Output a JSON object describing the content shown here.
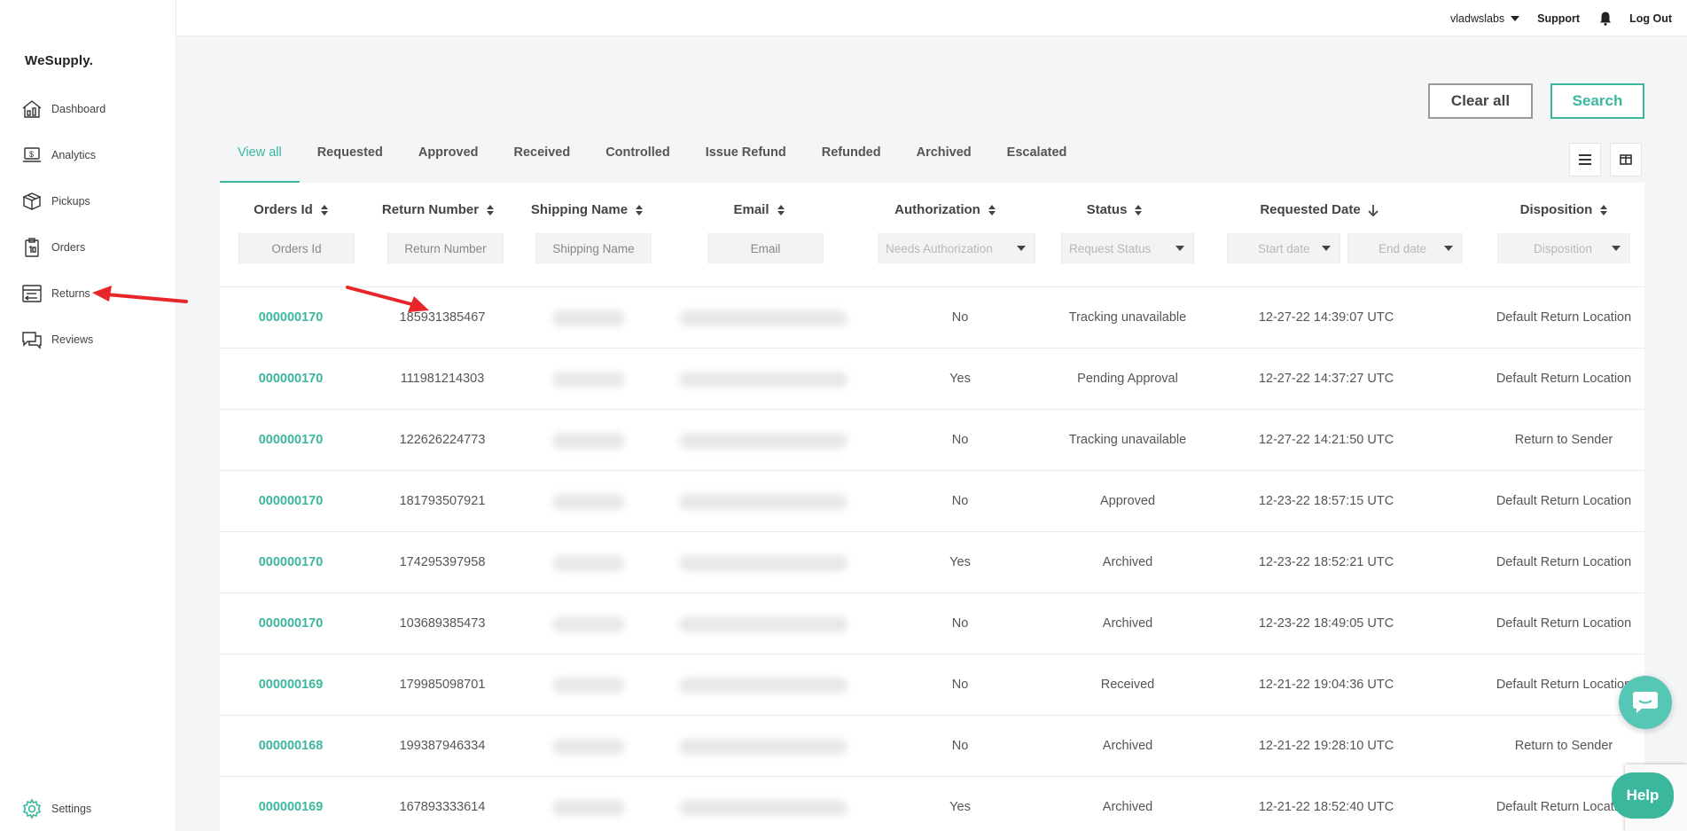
{
  "app": {
    "logo": "WeSupply."
  },
  "sidebar": {
    "items": [
      {
        "label": "Dashboard",
        "icon": "dashboard-icon"
      },
      {
        "label": "Analytics",
        "icon": "analytics-icon"
      },
      {
        "label": "Pickups",
        "icon": "box-icon"
      },
      {
        "label": "Orders",
        "icon": "clipboard-icon"
      },
      {
        "label": "Returns",
        "icon": "returns-icon"
      },
      {
        "label": "Reviews",
        "icon": "chat-icon"
      }
    ],
    "settings": {
      "label": "Settings",
      "icon": "gear-icon"
    }
  },
  "topbar": {
    "user": "vladwslabs",
    "support": "Support",
    "logout": "Log Out",
    "bell_icon": "bell-icon"
  },
  "actions": {
    "clear_label": "Clear all",
    "search_label": "Search"
  },
  "tabs": [
    "View all",
    "Requested",
    "Approved",
    "Received",
    "Controlled",
    "Issue Refund",
    "Refunded",
    "Archived",
    "Escalated"
  ],
  "view_toggles": {
    "list_icon": "list-view-icon",
    "grid_icon": "column-view-icon"
  },
  "table": {
    "columns": [
      {
        "label": "Orders Id",
        "filter": "Orders Id"
      },
      {
        "label": "Return Number",
        "filter": "Return Number"
      },
      {
        "label": "Shipping Name",
        "filter": "Shipping Name"
      },
      {
        "label": "Email",
        "filter": "Email"
      },
      {
        "label": "Authorization",
        "filter": "Needs Authorization"
      },
      {
        "label": "Status",
        "filter": "Request Status"
      },
      {
        "label": "Requested Date",
        "filter_start": "Start date",
        "filter_end": "End date"
      },
      {
        "label": "Disposition",
        "filter": "Disposition"
      }
    ],
    "rows": [
      {
        "order": "000000170",
        "return": "185931385467",
        "auth": "No",
        "status": "Tracking unavailable",
        "date": "12-27-22 14:39:07 UTC",
        "disposition": "Default Return Location"
      },
      {
        "order": "000000170",
        "return": "111981214303",
        "auth": "Yes",
        "status": "Pending Approval",
        "date": "12-27-22 14:37:27 UTC",
        "disposition": "Default Return Location"
      },
      {
        "order": "000000170",
        "return": "122626224773",
        "auth": "No",
        "status": "Tracking unavailable",
        "date": "12-27-22 14:21:50 UTC",
        "disposition": "Return to Sender"
      },
      {
        "order": "000000170",
        "return": "181793507921",
        "auth": "No",
        "status": "Approved",
        "date": "12-23-22 18:57:15 UTC",
        "disposition": "Default Return Location"
      },
      {
        "order": "000000170",
        "return": "174295397958",
        "auth": "Yes",
        "status": "Archived",
        "date": "12-23-22 18:52:21 UTC",
        "disposition": "Default Return Location"
      },
      {
        "order": "000000170",
        "return": "103689385473",
        "auth": "No",
        "status": "Archived",
        "date": "12-23-22 18:49:05 UTC",
        "disposition": "Default Return Location"
      },
      {
        "order": "000000169",
        "return": "179985098701",
        "auth": "No",
        "status": "Received",
        "date": "12-21-22 19:04:36 UTC",
        "disposition": "Default Return Location"
      },
      {
        "order": "000000168",
        "return": "199387946334",
        "auth": "No",
        "status": "Archived",
        "date": "12-21-22 19:28:10 UTC",
        "disposition": "Return to Sender"
      },
      {
        "order": "000000169",
        "return": "167893333614",
        "auth": "Yes",
        "status": "Archived",
        "date": "12-21-22 18:52:40 UTC",
        "disposition": "Default Return Location"
      }
    ]
  },
  "widgets": {
    "help_label": "Help"
  },
  "colors": {
    "accent": "#3bb79e",
    "annotation": "#e8262a"
  }
}
